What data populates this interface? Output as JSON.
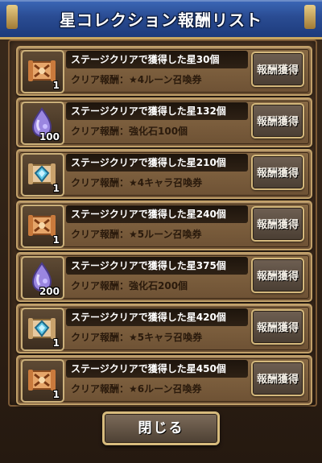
{
  "header": {
    "title": "星コレクション報酬リスト"
  },
  "rows": [
    {
      "condition": "ステージクリアで獲得した星30個",
      "reward": "クリア報酬：★4ルーン召喚券",
      "count": "1",
      "icon": "rune-scroll-icon",
      "button": "報酬獲得"
    },
    {
      "condition": "ステージクリアで獲得した星132個",
      "reward": "クリア報酬：強化石100個",
      "count": "100",
      "icon": "enhance-stone-icon",
      "button": "報酬獲得"
    },
    {
      "condition": "ステージクリアで獲得した星210個",
      "reward": "クリア報酬：★4キャラ召喚券",
      "count": "1",
      "icon": "character-scroll-icon",
      "button": "報酬獲得"
    },
    {
      "condition": "ステージクリアで獲得した星240個",
      "reward": "クリア報酬：★5ルーン召喚券",
      "count": "1",
      "icon": "rune-scroll-icon",
      "button": "報酬獲得"
    },
    {
      "condition": "ステージクリアで獲得した星375個",
      "reward": "クリア報酬：強化石200個",
      "count": "200",
      "icon": "enhance-stone-icon",
      "button": "報酬獲得"
    },
    {
      "condition": "ステージクリアで獲得した星420個",
      "reward": "クリア報酬：★5キャラ召喚券",
      "count": "1",
      "icon": "character-scroll-icon",
      "button": "報酬獲得"
    },
    {
      "condition": "ステージクリアで獲得した星450個",
      "reward": "クリア報酬：★6ルーン召喚券",
      "count": "1",
      "icon": "rune-scroll-icon",
      "button": "報酬獲得"
    }
  ],
  "close_button": {
    "label": "閉じる"
  }
}
